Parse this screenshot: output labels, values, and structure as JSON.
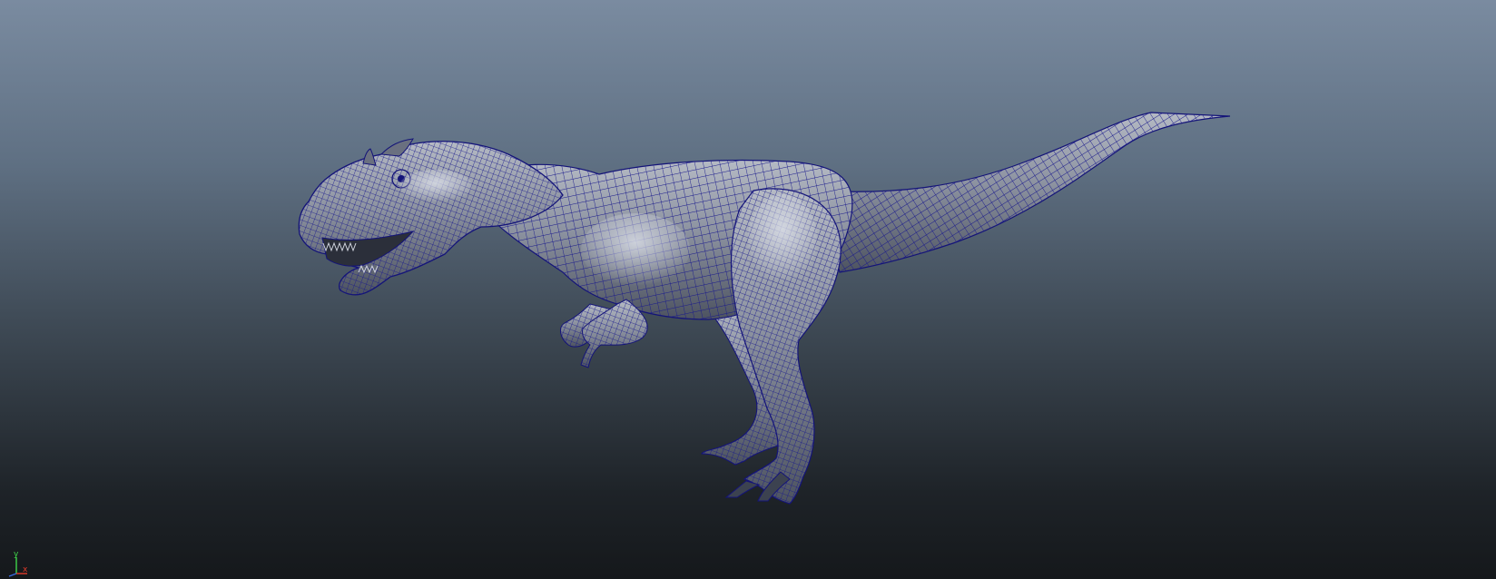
{
  "viewport": {
    "background_top": "#7a8ba0",
    "background_bottom": "#15181b",
    "wireframe_color": "#1a1a8c",
    "mesh_shade_light": "#a7adb8",
    "mesh_shade_dark": "#4a505c"
  },
  "model": {
    "icon": "dinosaur-mesh"
  },
  "axis": {
    "y_label": "y",
    "x_label": "x",
    "y_color": "#3fd44a",
    "x_color": "#e23a2a",
    "z_color": "#3a6ce2"
  }
}
